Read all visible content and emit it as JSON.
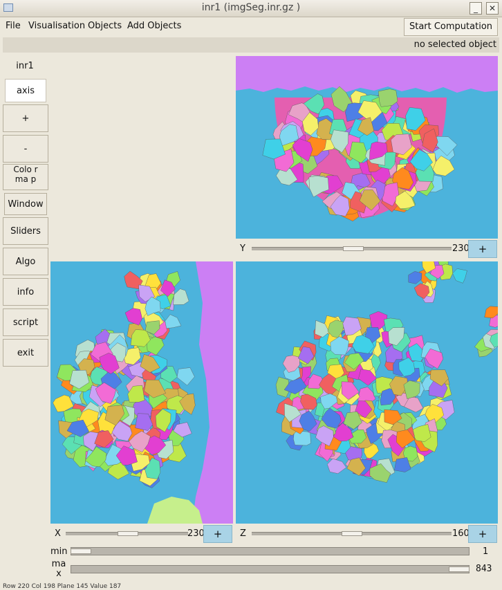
{
  "window": {
    "title": "inr1 (imgSeg.inr.gz  )"
  },
  "menu": [
    "File",
    "Visualisation",
    "Objects",
    "Add Objects"
  ],
  "toolbar": {
    "start_label": "Start Computation"
  },
  "status": {
    "selection": "no selected object",
    "cursor": "Row 220 Col 198 Plane 145 Value 187"
  },
  "sidebar": {
    "view_name": "inr1",
    "buttons": [
      "axis",
      "+",
      "-",
      "Colo rma p",
      "Window",
      "Sliders",
      "Algo",
      "info",
      "script",
      "exit"
    ]
  },
  "views": {
    "y": {
      "label": "Y",
      "value": "230",
      "level": 0.51,
      "plus": "+"
    },
    "x": {
      "label": "X",
      "value": "230",
      "level": 0.51,
      "plus": "+"
    },
    "z": {
      "label": "Z",
      "value": "160",
      "level": 0.5,
      "plus": "+"
    }
  },
  "range": {
    "min": {
      "label": "min",
      "value": "1",
      "level": 0.0
    },
    "max": {
      "label": "ma x",
      "value": "843",
      "level": 1.0
    }
  },
  "colors": {
    "background": "#4cb3dc",
    "outer": "#cc7ff4",
    "plus_button": "#a9d3e6"
  }
}
